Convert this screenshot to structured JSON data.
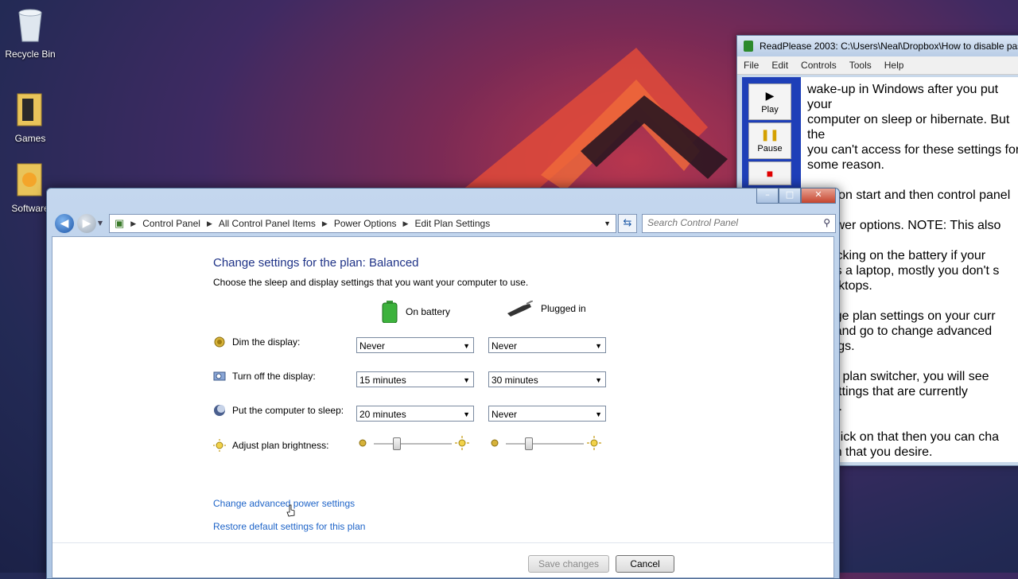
{
  "desktop": {
    "icons": [
      {
        "label": "Recycle Bin"
      },
      {
        "label": "Games"
      },
      {
        "label": "Software"
      }
    ]
  },
  "readplease": {
    "title": "ReadPlease 2003: C:\\Users\\Neal\\Dropbox\\How to disable pas",
    "menu": [
      "File",
      "Edit",
      "Controls",
      "Tools",
      "Help"
    ],
    "buttons": {
      "play": "Play",
      "pause": "Pause"
    },
    "text": "wake-up in Windows after you put your\ncomputer on sleep or hibernate. But the\nyou can't access for these settings for\nsome reason.\n\nClick on start and then control panel an\nto power options. NOTE: This also cou\nby clicking on the battery if your\nuter is a laptop, mostly you don't s\nn desktops.\n\nchange plan settings on your curr\nplan and go to change advanced\nsettings.\n\ne that plan switcher, you will see\nge settings that are currently\nlable\".\n\nyou click on that then you can cha\noption that you desire.\n\ngo to Require passowrd on wake\nthere should be two options. You\nput them on no."
  },
  "controlpanel": {
    "window_buttons": {
      "minimize": "–",
      "maximize": "□",
      "close": "✕"
    },
    "breadcrumbs": [
      "Control Panel",
      "All Control Panel Items",
      "Power Options",
      "Edit Plan Settings"
    ],
    "search_placeholder": "Search Control Panel",
    "heading": "Change settings for the plan: Balanced",
    "subheading": "Choose the sleep and display settings that you want your computer to use.",
    "columns": {
      "battery": "On battery",
      "plugged": "Plugged in"
    },
    "settings": [
      {
        "label": "Dim the display:",
        "battery": "Never",
        "plugged": "Never"
      },
      {
        "label": "Turn off the display:",
        "battery": "15 minutes",
        "plugged": "30 minutes"
      },
      {
        "label": "Put the computer to sleep:",
        "battery": "20 minutes",
        "plugged": "Never"
      }
    ],
    "brightness": {
      "label": "Adjust plan brightness:",
      "battery_level": 0.3,
      "plugged_level": 0.3
    },
    "links": {
      "advanced": "Change advanced power settings",
      "restore": "Restore default settings for this plan"
    },
    "buttons": {
      "save": "Save changes",
      "cancel": "Cancel"
    }
  },
  "colors": {
    "link": "#1e64c8",
    "heading": "#1e3287"
  }
}
